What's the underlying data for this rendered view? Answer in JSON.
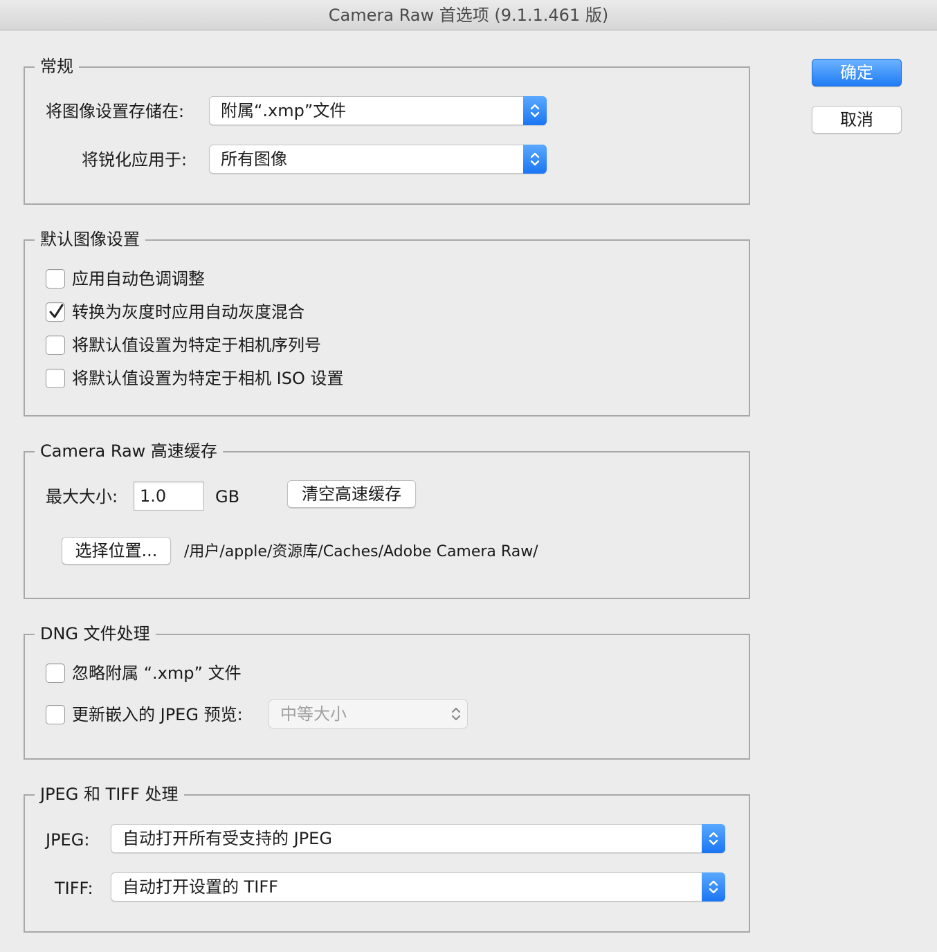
{
  "window": {
    "title": "Camera Raw 首选项 (9.1.1.461 版)"
  },
  "buttons": {
    "ok": "确定",
    "cancel": "取消"
  },
  "general": {
    "title": "常规",
    "save_settings_label": "将图像设置存储在:",
    "save_settings_value": "附属“.xmp”文件",
    "sharpen_label": "将锐化应用于:",
    "sharpen_value": "所有图像"
  },
  "defaults": {
    "title": "默认图像设置",
    "options": [
      {
        "label": "应用自动色调调整",
        "checked": false
      },
      {
        "label": "转换为灰度时应用自动灰度混合",
        "checked": true
      },
      {
        "label": "将默认值设置为特定于相机序列号",
        "checked": false
      },
      {
        "label": "将默认值设置为特定于相机 ISO 设置",
        "checked": false
      }
    ]
  },
  "cache": {
    "title": "Camera Raw 高速缓存",
    "max_size_label": "最大大小:",
    "max_size_value": "1.0",
    "unit": "GB",
    "purge_button": "清空高速缓存",
    "select_location_button": "选择位置...",
    "path": "/用户/apple/资源库/Caches/Adobe Camera Raw/"
  },
  "dng": {
    "title": "DNG 文件处理",
    "ignore_xmp_label": "忽略附属 “.xmp” 文件",
    "ignore_xmp_checked": false,
    "update_preview_label": "更新嵌入的 JPEG 预览:",
    "update_preview_checked": false,
    "preview_size_value": "中等大小"
  },
  "jpeg_tiff": {
    "title": "JPEG 和 TIFF 处理",
    "jpeg_label": "JPEG:",
    "jpeg_value": "自动打开所有受支持的 JPEG",
    "tiff_label": "TIFF:",
    "tiff_value": "自动打开设置的 TIFF"
  },
  "colors": {
    "accent": "#1f7cf4",
    "background": "#ececec"
  }
}
